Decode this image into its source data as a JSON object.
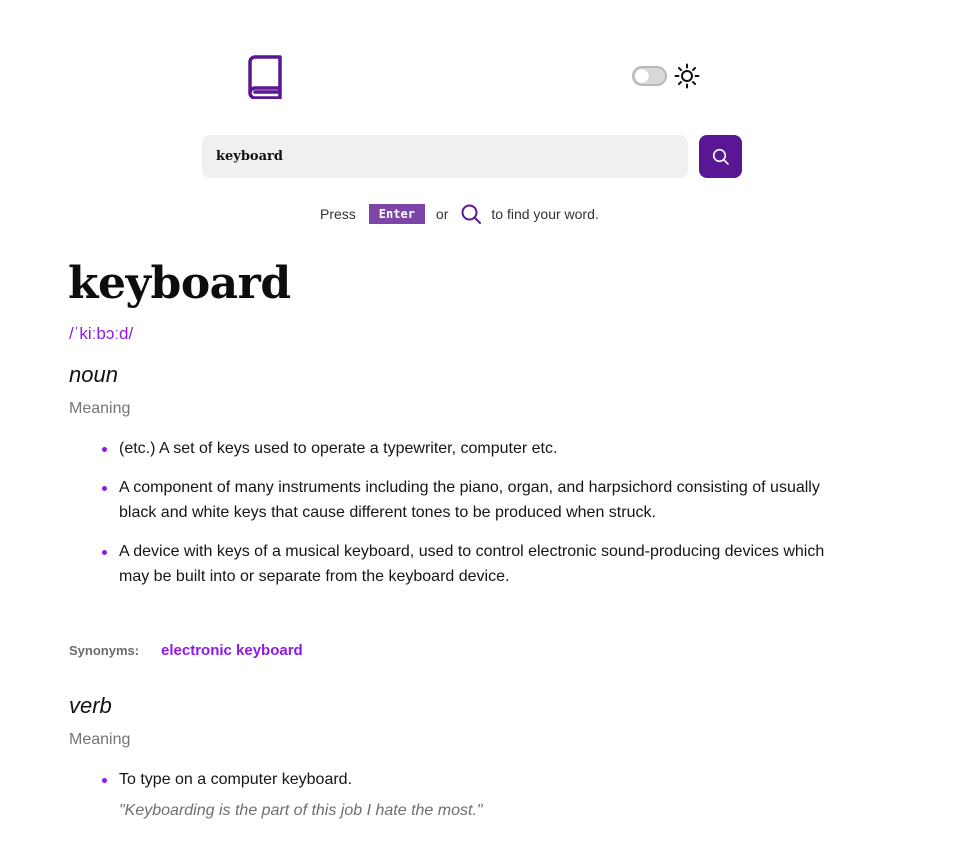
{
  "header": {
    "logo_icon": "book-icon",
    "theme_toggle_state": "off",
    "theme_icon": "sun-icon"
  },
  "search": {
    "value": "keyboard",
    "button_icon": "search-icon"
  },
  "hint": {
    "press": "Press",
    "key": "Enter",
    "or": "or",
    "icon": "search-icon",
    "suffix": "to find your word."
  },
  "entry": {
    "word": "keyboard",
    "phonetic": "/ˈkiːbɔːd/",
    "meanings": [
      {
        "part_of_speech": "noun",
        "meaning_label": "Meaning",
        "definitions": [
          "(etc.) A set of keys used to operate a typewriter, computer etc.",
          "A component of many instruments including the piano, organ, and harpsichord consisting of usually black and white keys that cause different tones to be produced when struck.",
          "A device with keys of a musical keyboard, used to control electronic sound-producing devices which may be built into or separate from the keyboard device."
        ],
        "synonyms_label": "Synonyms:",
        "synonyms": [
          "electronic keyboard"
        ]
      },
      {
        "part_of_speech": "verb",
        "meaning_label": "Meaning",
        "definitions": [
          "To type on a computer keyboard."
        ],
        "example": "\"Keyboarding is the part of this job I hate the most.\""
      }
    ]
  },
  "colors": {
    "accent": "#8f1ae6",
    "button": "#5a1793",
    "key_badge": "#7e45a8",
    "input_bg": "#eff0f2"
  }
}
